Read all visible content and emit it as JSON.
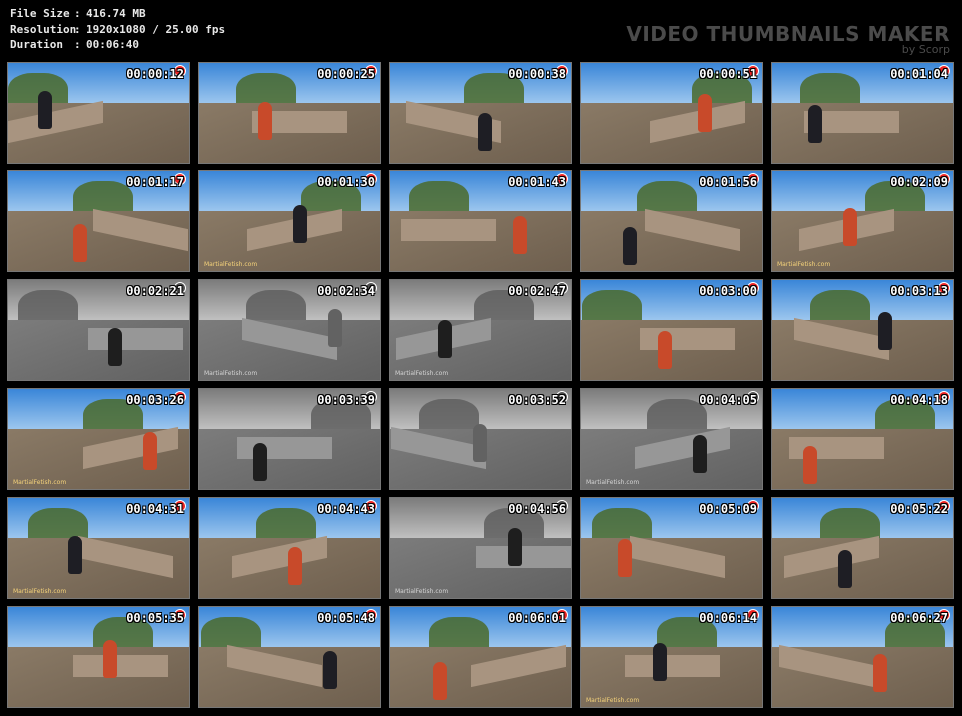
{
  "info": {
    "file_size_label": "File Size",
    "file_size_value": "416.74 MB",
    "resolution_label": "Resolution",
    "resolution_value": "1920x1080 / 25.00 fps",
    "duration_label": "Duration",
    "duration_value": "00:06:40"
  },
  "watermark": {
    "title": "VIDEO THUMBNAILS MAKER",
    "by": "by Scorp"
  },
  "thumbnails": [
    {
      "time": "00:00:12",
      "bw": false,
      "brand": ""
    },
    {
      "time": "00:00:25",
      "bw": false,
      "brand": ""
    },
    {
      "time": "00:00:38",
      "bw": false,
      "brand": ""
    },
    {
      "time": "00:00:51",
      "bw": false,
      "brand": ""
    },
    {
      "time": "00:01:04",
      "bw": false,
      "brand": ""
    },
    {
      "time": "00:01:17",
      "bw": false,
      "brand": ""
    },
    {
      "time": "00:01:30",
      "bw": false,
      "brand": "MartialFetish.com"
    },
    {
      "time": "00:01:43",
      "bw": false,
      "brand": ""
    },
    {
      "time": "00:01:56",
      "bw": false,
      "brand": ""
    },
    {
      "time": "00:02:09",
      "bw": false,
      "brand": "MartialFetish.com"
    },
    {
      "time": "00:02:21",
      "bw": true,
      "brand": ""
    },
    {
      "time": "00:02:34",
      "bw": true,
      "brand": "MartialFetish.com"
    },
    {
      "time": "00:02:47",
      "bw": true,
      "brand": "MartialFetish.com"
    },
    {
      "time": "00:03:00",
      "bw": false,
      "brand": ""
    },
    {
      "time": "00:03:13",
      "bw": false,
      "brand": ""
    },
    {
      "time": "00:03:26",
      "bw": false,
      "brand": "MartialFetish.com"
    },
    {
      "time": "00:03:39",
      "bw": true,
      "brand": ""
    },
    {
      "time": "00:03:52",
      "bw": true,
      "brand": ""
    },
    {
      "time": "00:04:05",
      "bw": true,
      "brand": "MartialFetish.com"
    },
    {
      "time": "00:04:18",
      "bw": false,
      "brand": ""
    },
    {
      "time": "00:04:31",
      "bw": false,
      "brand": "MartialFetish.com"
    },
    {
      "time": "00:04:43",
      "bw": false,
      "brand": ""
    },
    {
      "time": "00:04:56",
      "bw": true,
      "brand": "MartialFetish.com"
    },
    {
      "time": "00:05:09",
      "bw": false,
      "brand": ""
    },
    {
      "time": "00:05:22",
      "bw": false,
      "brand": ""
    },
    {
      "time": "00:05:35",
      "bw": false,
      "brand": ""
    },
    {
      "time": "00:05:48",
      "bw": false,
      "brand": ""
    },
    {
      "time": "00:06:01",
      "bw": false,
      "brand": ""
    },
    {
      "time": "00:06:14",
      "bw": false,
      "brand": "MartialFetish.com"
    },
    {
      "time": "00:06:27",
      "bw": false,
      "brand": ""
    }
  ],
  "colors": {
    "sky": "#3a86d8",
    "ground": "#8a7a66",
    "wall": "#a89480",
    "foliage": "#4a6a2a",
    "figure_dark": "#1e1e24",
    "figure_red": "#c84a2a"
  }
}
